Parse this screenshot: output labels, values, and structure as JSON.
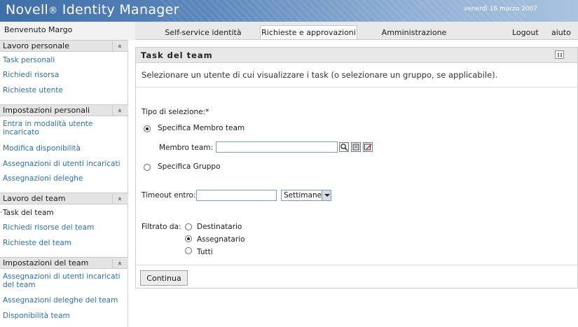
{
  "header": {
    "brand": "Novell",
    "brand_suffix": "Identity Manager",
    "reg": "®",
    "date": "venerdì 16 marzo 2007"
  },
  "nav": {
    "welcome": "Benvenuto Margo",
    "tabs": [
      {
        "label": "Self-service identità",
        "active": false
      },
      {
        "label": "Richieste e approvazioni",
        "active": true
      },
      {
        "label": "Amministrazione",
        "active": false
      }
    ],
    "logout": "Logout",
    "help": "aiuto"
  },
  "sidebar": {
    "sections": [
      {
        "title": "Lavoro personale",
        "items": [
          "Task personali",
          "Richiedi risorsa",
          "Richieste utente"
        ]
      },
      {
        "title": "Impostazioni personali",
        "items": [
          "Entra in modalità utente incaricato",
          "Modifica disponibilità",
          "Assegnazioni di utenti incaricati",
          "Assegnazioni deleghe"
        ]
      },
      {
        "title": "Lavoro del team",
        "items": [
          "Task del team",
          "Richiedi risorse del team",
          "Richieste del team"
        ],
        "current": "Task del team"
      },
      {
        "title": "Impostazioni del team",
        "items": [
          "Assegnazioni di utenti incaricati del team",
          "Assegnazioni deleghe del team",
          "Disponibilità team"
        ]
      }
    ]
  },
  "panel": {
    "title": "Task del team",
    "description": "Selezionare un utente di cui visualizzare i task (o selezionare un gruppo, se applicabile).",
    "selection_type_label": "Tipo di selezione:*",
    "option_member": "Specifica Membro team",
    "member_label": "Membro team:",
    "member_value": "",
    "option_group": "Specifica Gruppo",
    "timeout_label": "Timeout entro:",
    "timeout_value": "",
    "timeout_unit": "Settimane",
    "filter_label": "Filtrato da:",
    "filter_options": [
      "Destinatario",
      "Assegnatario",
      "Tutti"
    ],
    "filter_selected": "Assegnatario",
    "continue_label": "Continua"
  }
}
